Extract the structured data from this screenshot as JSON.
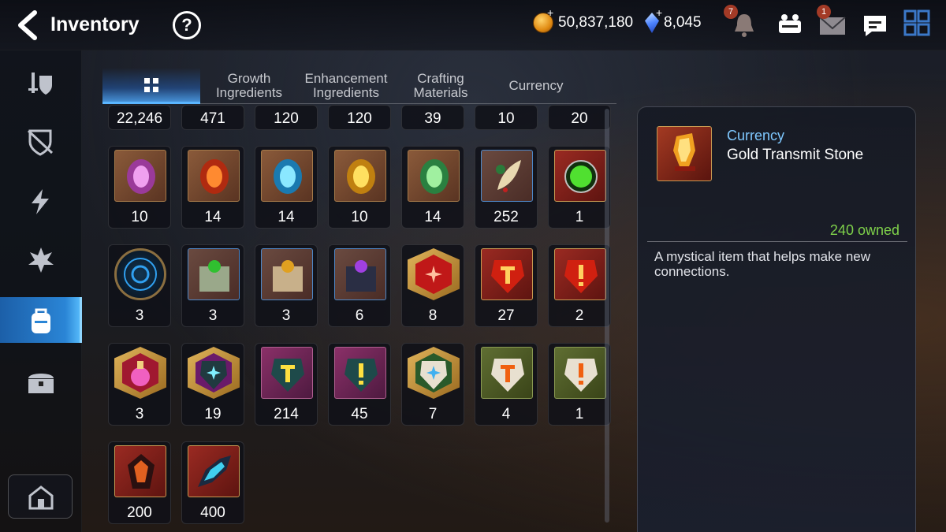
{
  "header": {
    "title": "Inventory",
    "help_glyph": "?",
    "gold_amount": "50,837,180",
    "gem_amount": "8,045",
    "notification_badge": "7",
    "mail_badge": "1",
    "icons": [
      "back-arrow-icon",
      "help-icon",
      "gold-coin-icon",
      "crystal-icon",
      "bell-icon",
      "party-icon",
      "mail-icon",
      "chat-icon",
      "menu-grid-icon"
    ]
  },
  "sidebar": {
    "items": [
      {
        "icon": "sword-shield-icon"
      },
      {
        "icon": "broken-shield-icon"
      },
      {
        "icon": "lightning-icon"
      },
      {
        "icon": "burst-icon"
      },
      {
        "icon": "backpack-icon",
        "active": true
      },
      {
        "icon": "chest-icon"
      }
    ],
    "home_icon": "home-icon"
  },
  "tabs": [
    {
      "label": "",
      "icon": "grid-icon",
      "active": true
    },
    {
      "label": "Growth Ingredients"
    },
    {
      "label": "Enhancement Ingredients"
    },
    {
      "label": "Crafting Materials"
    },
    {
      "label": "Currency"
    }
  ],
  "inventory": {
    "partial_row": [
      "22,246",
      "471",
      "120",
      "120",
      "39",
      "10",
      "20"
    ],
    "rows": [
      [
        {
          "count": "10",
          "icon": "purple-rune-icon"
        },
        {
          "count": "14",
          "icon": "fire-rune-icon"
        },
        {
          "count": "14",
          "icon": "ice-rune-icon"
        },
        {
          "count": "10",
          "icon": "light-rune-icon"
        },
        {
          "count": "14",
          "icon": "earth-rune-icon"
        },
        {
          "count": "252",
          "icon": "feather-leaf-icon"
        },
        {
          "count": "1",
          "icon": "green-orb-icon"
        }
      ],
      [
        {
          "count": "3",
          "icon": "blue-sigil-icon"
        },
        {
          "count": "3",
          "icon": "green-gem-chest-icon"
        },
        {
          "count": "3",
          "icon": "gold-gem-chest-icon"
        },
        {
          "count": "6",
          "icon": "dark-gem-chest-icon"
        },
        {
          "count": "8",
          "icon": "red-star-stone-icon"
        },
        {
          "count": "27",
          "icon": "red-t-stone-icon"
        },
        {
          "count": "2",
          "icon": "red-exclaim-stone-icon"
        }
      ],
      [
        {
          "count": "3",
          "icon": "pink-potion-icon"
        },
        {
          "count": "19",
          "icon": "purple-star-stone-icon"
        },
        {
          "count": "214",
          "icon": "purple-t-stone-icon"
        },
        {
          "count": "45",
          "icon": "purple-exclaim-stone-icon"
        },
        {
          "count": "7",
          "icon": "white-star-stone-icon"
        },
        {
          "count": "4",
          "icon": "white-t-stone-icon"
        },
        {
          "count": "1",
          "icon": "white-exclaim-stone-icon"
        }
      ],
      [
        {
          "count": "200",
          "icon": "dark-crystal-icon"
        },
        {
          "count": "400",
          "icon": "blue-crystal-icon"
        }
      ]
    ]
  },
  "detail": {
    "category": "Currency",
    "name": "Gold Transmit Stone",
    "owned": "240 owned",
    "description": "A mystical item that helps make new connections.",
    "icon": "gold-transmit-stone-icon"
  },
  "colors": {
    "accent": "#2a85d6",
    "owned_green": "#7ed04a",
    "category_blue": "#7fc8ff"
  }
}
